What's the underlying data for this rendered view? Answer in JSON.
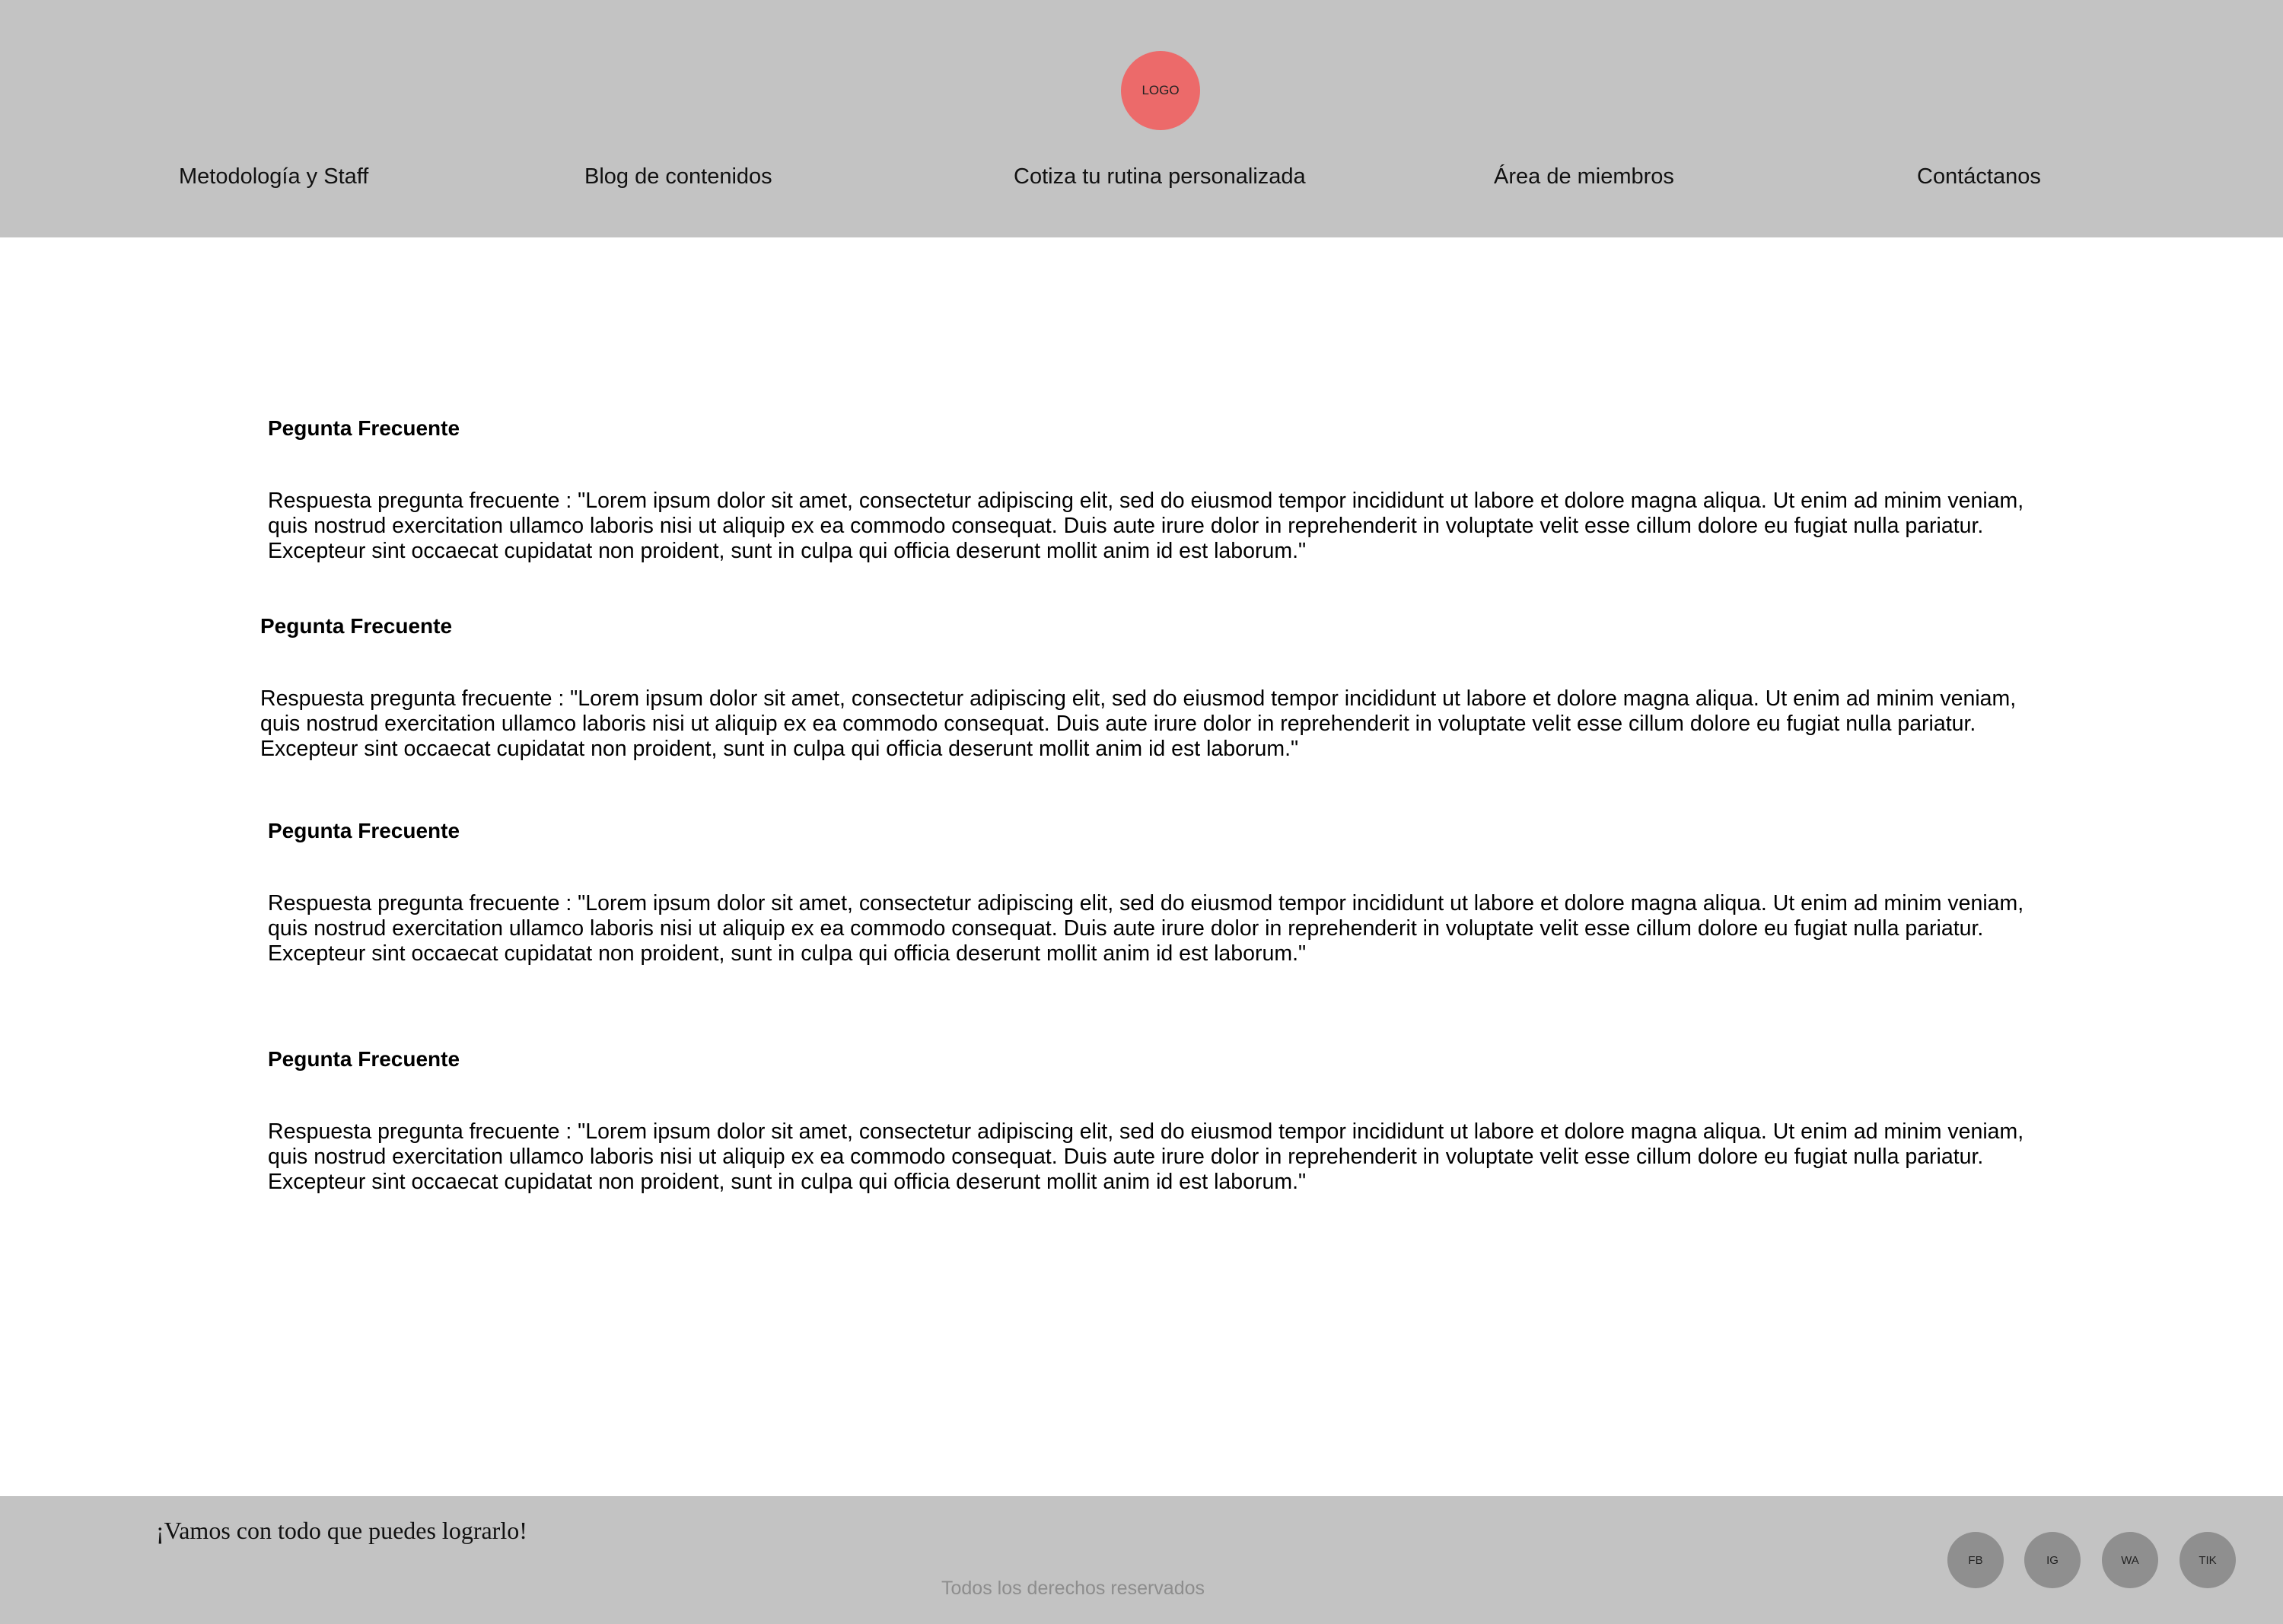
{
  "header": {
    "logo_label": "LOGO",
    "nav": [
      {
        "label": "Metodología y Staff"
      },
      {
        "label": "Blog de contenidos"
      },
      {
        "label": "Cotiza tu rutina personalizada"
      },
      {
        "label": "Área de miembros"
      },
      {
        "label": "Contáctanos"
      }
    ]
  },
  "faq": [
    {
      "question": "Pegunta Frecuente",
      "answer": "Respuesta pregunta frecuente :  \"Lorem ipsum dolor sit amet, consectetur adipiscing elit, sed do eiusmod tempor incididunt ut labore et dolore magna aliqua. Ut enim ad minim veniam, quis nostrud exercitation ullamco laboris nisi ut aliquip ex ea commodo consequat. Duis aute irure dolor in reprehenderit in voluptate velit esse cillum dolore eu fugiat nulla pariatur. Excepteur sint occaecat cupidatat non proident, sunt in culpa qui officia deserunt mollit anim id est laborum.\""
    },
    {
      "question": "Pegunta Frecuente",
      "answer": "Respuesta pregunta frecuente :  \"Lorem ipsum dolor sit amet, consectetur adipiscing elit, sed do eiusmod tempor incididunt ut labore et dolore magna aliqua. Ut enim ad minim veniam, quis nostrud exercitation ullamco laboris nisi ut aliquip ex ea commodo consequat. Duis aute irure dolor in reprehenderit in voluptate velit esse cillum dolore eu fugiat nulla pariatur. Excepteur sint occaecat cupidatat non proident, sunt in culpa qui officia deserunt mollit anim id est laborum.\""
    },
    {
      "question": "Pegunta Frecuente",
      "answer": "Respuesta pregunta frecuente :  \"Lorem ipsum dolor sit amet, consectetur adipiscing elit, sed do eiusmod tempor incididunt ut labore et dolore magna aliqua. Ut enim ad minim veniam, quis nostrud exercitation ullamco laboris nisi ut aliquip ex ea commodo consequat. Duis aute irure dolor in reprehenderit in voluptate velit esse cillum dolore eu fugiat nulla pariatur. Excepteur sint occaecat cupidatat non proident, sunt in culpa qui officia deserunt mollit anim id est laborum.\""
    },
    {
      "question": "Pegunta Frecuente",
      "answer": "Respuesta pregunta frecuente :  \"Lorem ipsum dolor sit amet, consectetur adipiscing elit, sed do eiusmod tempor incididunt ut labore et dolore magna aliqua. Ut enim ad minim veniam, quis nostrud exercitation ullamco laboris nisi ut aliquip ex ea commodo consequat. Duis aute irure dolor in reprehenderit in voluptate velit esse cillum dolore eu fugiat nulla pariatur. Excepteur sint occaecat cupidatat non proident, sunt in culpa qui officia deserunt mollit anim id est laborum.\""
    }
  ],
  "footer": {
    "slogan": "¡Vamos con todo que puedes lograrlo!",
    "copyright": "Todos los derechos reservados",
    "social": [
      {
        "label": "FB",
        "icon": "facebook-icon"
      },
      {
        "label": "IG",
        "icon": "instagram-icon"
      },
      {
        "label": "WA",
        "icon": "whatsapp-icon"
      },
      {
        "label": "TIK",
        "icon": "tiktok-icon"
      }
    ]
  },
  "colors": {
    "header_bg": "#c3c3c3",
    "logo_bg": "#ec6a6a",
    "social_bg": "#8f8f8f",
    "muted_text": "#8d8d8d"
  }
}
